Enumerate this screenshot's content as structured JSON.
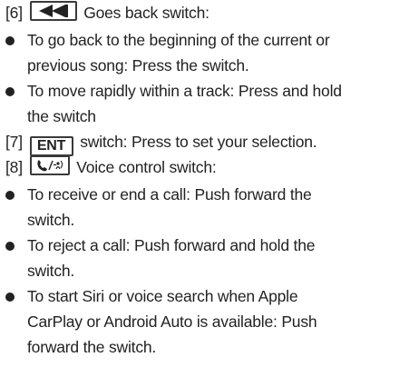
{
  "items": {
    "back": {
      "index": "[6]",
      "text": "Goes back switch:",
      "bullet1": [
        "To go back to the beginning of the current or",
        "previous song: Press the switch."
      ],
      "bullet2": [
        "To move rapidly within a track: Press and hold",
        "the switch"
      ]
    },
    "ent": {
      "index": "[7]",
      "key_label": "ENT",
      "text": "switch: Press to set your selection."
    },
    "voice": {
      "index": "[8]",
      "text": "Voice control switch:",
      "bullet1": [
        "To receive or end a call: Push forward the",
        "switch."
      ],
      "bullet2": [
        "To reject a call: Push forward and hold the",
        "switch."
      ],
      "bullet3": [
        "To start Siri or voice search when Apple",
        "CarPlay or Android Auto is available: Push",
        "forward the switch."
      ]
    }
  },
  "icons": {
    "back_key": "rewind-icon",
    "voice_key": "phone-voice-icon"
  }
}
